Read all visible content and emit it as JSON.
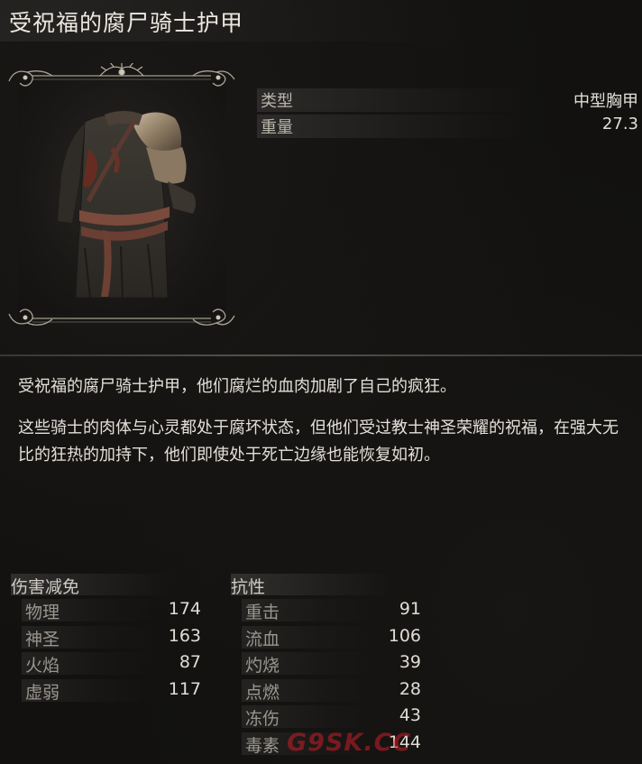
{
  "item": {
    "name": "受祝福的腐尸骑士护甲",
    "properties": [
      {
        "label": "类型",
        "value": "中型胸甲"
      },
      {
        "label": "重量",
        "value": "27.3"
      }
    ]
  },
  "description": {
    "paragraph1": "受祝福的腐尸骑士护甲，他们腐烂的血肉加剧了自己的疯狂。",
    "paragraph2": "这些骑士的肉体与心灵都处于腐坏状态，但他们受过教士神圣荣耀的祝福，在强大无比的狂热的加持下，他们即使处于死亡边缘也能恢复如初。"
  },
  "damage_negation": {
    "heading": "伤害减免",
    "rows": [
      {
        "label": "物理",
        "value": "174"
      },
      {
        "label": "神圣",
        "value": "163"
      },
      {
        "label": "火焰",
        "value": "87"
      },
      {
        "label": "虚弱",
        "value": "117"
      }
    ]
  },
  "resistance": {
    "heading": "抗性",
    "rows": [
      {
        "label": "重击",
        "value": "91"
      },
      {
        "label": "流血",
        "value": "106"
      },
      {
        "label": "灼烧",
        "value": "39"
      },
      {
        "label": "点燃",
        "value": "28"
      },
      {
        "label": "冻伤",
        "value": "43"
      },
      {
        "label": "毒素",
        "value": "144"
      }
    ]
  },
  "watermark": "G9SK.CC",
  "icons": {
    "armor": "armor-chest-icon",
    "frame": "ornate-frame"
  }
}
